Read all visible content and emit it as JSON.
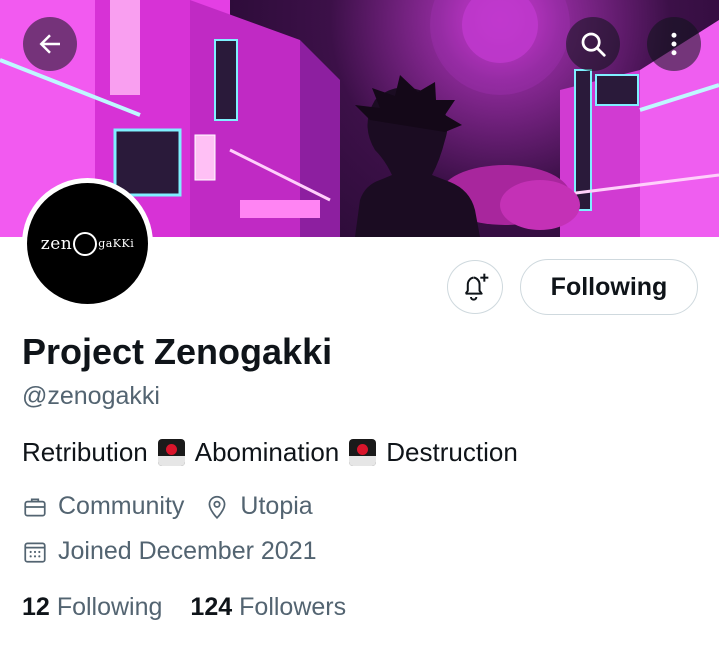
{
  "profile": {
    "display_name": "Project Zenogakki",
    "handle": "@zenogakki",
    "avatar_text": "zen",
    "avatar_text_suffix": "gaKKi",
    "bio": {
      "words": [
        "Retribution",
        "Abomination",
        "Destruction"
      ],
      "emoji": "japanese-dango-style-emoji"
    },
    "category": "Community",
    "location": "Utopia",
    "joined": "Joined December 2021",
    "following_count": "12",
    "following_label": "Following",
    "followers_count": "124",
    "followers_label": "Followers"
  },
  "actions": {
    "follow_state_label": "Following",
    "notify_icon": "bell-plus-icon"
  },
  "header_icons": {
    "back": "back-arrow-icon",
    "search": "search-icon",
    "more": "more-vertical-icon"
  },
  "colors": {
    "text_primary": "#0f1419",
    "text_secondary": "#536471",
    "border": "#cfd9de",
    "banner_magenta": "#e83ee8",
    "banner_purple": "#3c1048"
  }
}
